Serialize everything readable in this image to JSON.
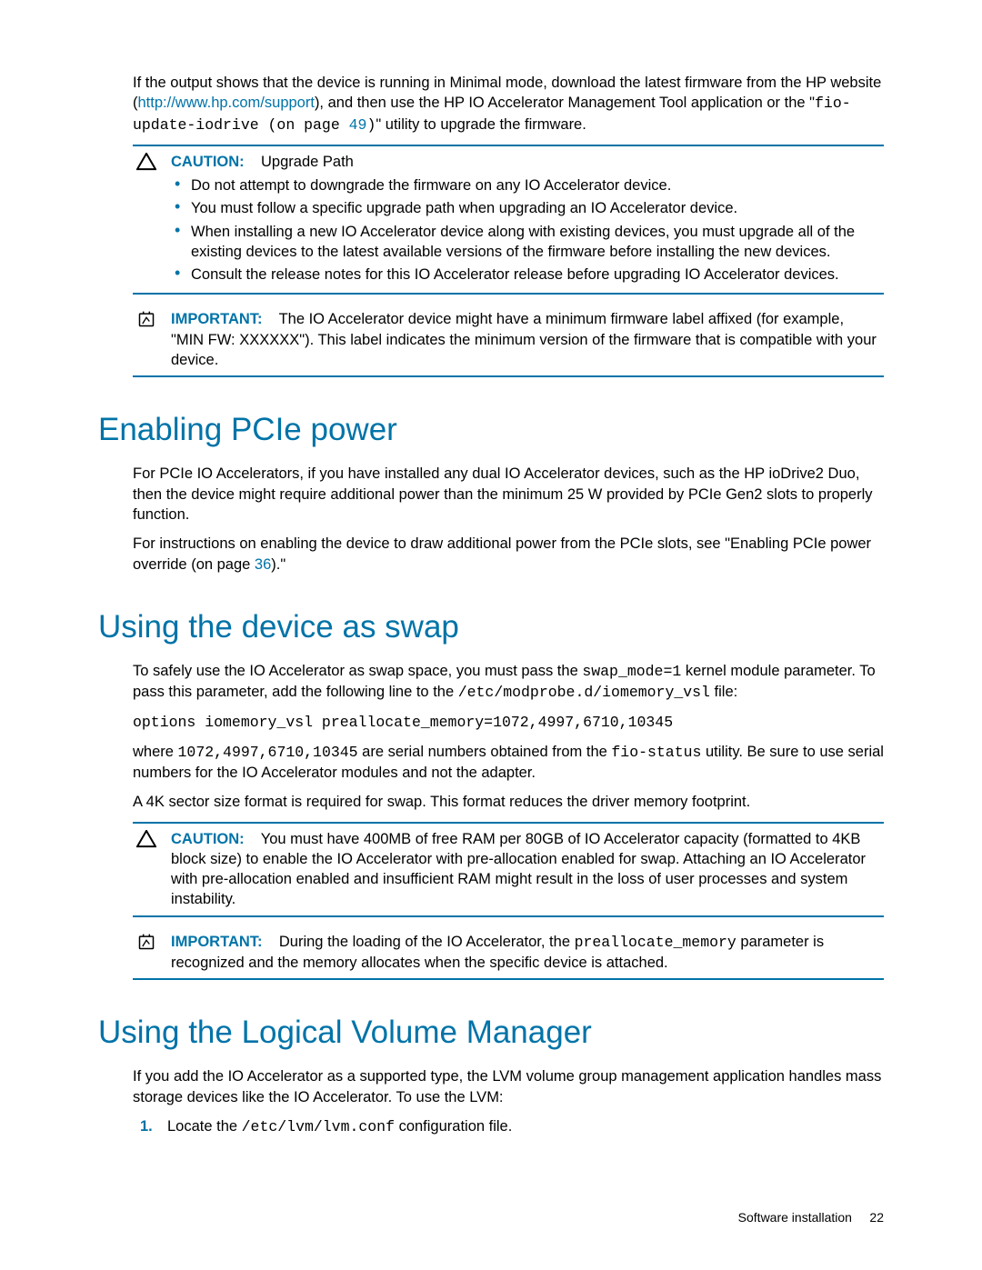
{
  "intro": {
    "p1a": "If the output shows that the device is running in Minimal mode, download the latest firmware from the HP website (",
    "link1": "http://www.hp.com/support",
    "p1b": "), and then use the HP IO Accelerator Management Tool application or the \"",
    "code1": "fio-update-iodrive (on page ",
    "pageref1": "49",
    "code1b": ")",
    "p1c": "\" utility to upgrade the firmware."
  },
  "caution1": {
    "label": "CAUTION:",
    "title": "Upgrade Path",
    "bullets": [
      "Do not attempt to downgrade the firmware on any IO Accelerator device.",
      "You must follow a specific upgrade path when upgrading an IO Accelerator device.",
      "When installing a new IO Accelerator device along with existing devices, you must upgrade all of the existing devices to the latest available versions of the firmware before installing the new devices.",
      "Consult the release notes for this IO Accelerator release before upgrading IO Accelerator devices."
    ]
  },
  "important1": {
    "label": "IMPORTANT:",
    "text": "The IO Accelerator device might have a minimum firmware label affixed (for example, \"MIN FW: XXXXXX\"). This label indicates the minimum version of the firmware that is compatible with your device."
  },
  "sec1": {
    "heading": "Enabling PCIe power",
    "p1": "For PCIe IO Accelerators, if you have installed any dual IO Accelerator devices, such as the HP ioDrive2 Duo, then the device might require additional power than the minimum 25 W provided by PCIe Gen2 slots to properly function.",
    "p2a": "For instructions on enabling the device to draw additional power from the PCIe slots, see \"Enabling PCIe power override (on page ",
    "pageref": "36",
    "p2b": ").\""
  },
  "sec2": {
    "heading": "Using the device as swap",
    "p1a": "To safely use the IO Accelerator as swap space, you must pass the ",
    "code1": "swap_mode=1",
    "p1b": " kernel module parameter. To pass this parameter, add the following line to the ",
    "code2": "/etc/modprobe.d/iomemory_vsl",
    "p1c": " file:",
    "codeblock": "options iomemory_vsl preallocate_memory=1072,4997,6710,10345",
    "p2a": "where ",
    "code3": "1072,4997,6710,10345",
    "p2b": " are serial numbers obtained from the ",
    "code4": "fio-status",
    "p2c": " utility. Be sure to use serial numbers for the IO Accelerator modules and not the adapter.",
    "p3": "A 4K sector size format is required for swap. This format reduces the driver memory footprint."
  },
  "caution2": {
    "label": "CAUTION:",
    "text": "You must have 400MB of free RAM per 80GB of IO Accelerator capacity (formatted to 4KB block size) to enable the IO Accelerator with pre-allocation enabled for swap. Attaching an IO Accelerator with pre-allocation enabled and insufficient RAM might result in the loss of user processes and system instability."
  },
  "important2": {
    "label": "IMPORTANT:",
    "text_a": "During the loading of the IO Accelerator, the ",
    "code": "preallocate_memory",
    "text_b": " parameter is recognized and the memory allocates when the specific device is attached."
  },
  "sec3": {
    "heading": "Using the Logical Volume Manager",
    "p1": "If you add the IO Accelerator as a supported type, the LVM volume group management application handles mass storage devices like the IO Accelerator. To use the LVM:",
    "step_num": "1.",
    "step_a": "Locate the ",
    "step_code": "/etc/lvm/lvm.conf",
    "step_b": " configuration file."
  },
  "footer": {
    "label": "Software installation",
    "page": "22"
  }
}
